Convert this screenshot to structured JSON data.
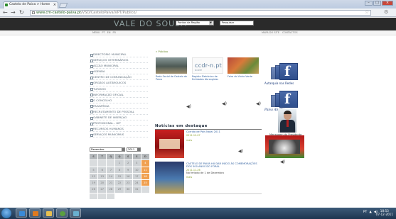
{
  "browser": {
    "tab_title": "Castelo de Paiva > Home",
    "url_main": "www.cm-castelo-paiva.pt",
    "url_rest": "/VSD/CasteloPaiva/VPT/Publico/"
  },
  "site": {
    "logo": "VALE DO SOUSA",
    "region_select": "Pontos da Região",
    "search_placeholder": "Pesquisar",
    "subnav_left": [
      "MENU",
      "PT",
      "EN",
      "FR"
    ],
    "subnav_right": [
      "MAPA DO SITE",
      "CONTACTOS"
    ]
  },
  "breadcrumb": "» Público",
  "menu": [
    "DIRECTÓRIO MUNICIPAL",
    "SERVIÇOS VETERINÁRIOS",
    "ACÇÃO MUNICIPAL",
    "AGENDA",
    "CENTRO DE COMUNICAÇÃO",
    "ÓRGÃOS AUTÁRQUICOS",
    "TURISMO",
    "INFORMAÇÃO OFICIAL",
    "O CONCELHO",
    "PAIVAPÉDIA",
    "RECRUTAMENTO DE PESSOAL",
    "GABINETE DE INSERÇÃO",
    "PROFISSIONAL - GIP",
    "RECURSOS HUMANOS",
    "SERVIÇOS MUNICIPAIS"
  ],
  "calendar": {
    "month": "Dezembro",
    "year": "2011",
    "weekdays": [
      "S",
      "T",
      "Q",
      "Q",
      "S",
      "S",
      "D"
    ],
    "days": [
      "",
      "",
      "",
      "1",
      "2",
      "3",
      "4",
      "5",
      "6",
      "7",
      "8",
      "9",
      "10",
      "11",
      "12",
      "13",
      "14",
      "15",
      "16",
      "17",
      "18",
      "19",
      "20",
      "21",
      "22",
      "23",
      "24",
      "25",
      "26",
      "27",
      "28",
      "29",
      "30",
      "31",
      "",
      "",
      "",
      ""
    ]
  },
  "tiles": [
    {
      "caption": "Rede Social de Castelo de Paiva"
    },
    {
      "caption": "Registo Eletrónico de Entidades Abrangidas",
      "logo": "ccdr-n.pt",
      "logo_small": "NORTE"
    },
    {
      "caption": "Feira do Vinho Verde"
    }
  ],
  "social": {
    "fb1_caption": "Autarquia nas Redes",
    "fb2_caption": "Paiva Aberto",
    "president_caption": "Mensagem do Presidente"
  },
  "news": {
    "title": "Notícias em destaque",
    "item1_title": "Corrida de Pais Natal 2011",
    "item1_date": "2011-12-07",
    "more": "mais",
    "item2_title": "CASTELO DE PAIVA HÁ DAR INÍCIO ÀS COMEMORAÇÕES DOS 500 ANOS DO FORAL",
    "item2_date": "2011-11-26",
    "item2_sub": "No feriado de 1 de Dezembro"
  },
  "taskbar": {
    "tray": "PT",
    "time": "18:53",
    "date": "07-12-2011"
  },
  "colors": {
    "site_header": "#2a2a2a",
    "menu_text": "#5a6a78",
    "weekend": "#f0a050",
    "facebook": "#3b5998"
  }
}
